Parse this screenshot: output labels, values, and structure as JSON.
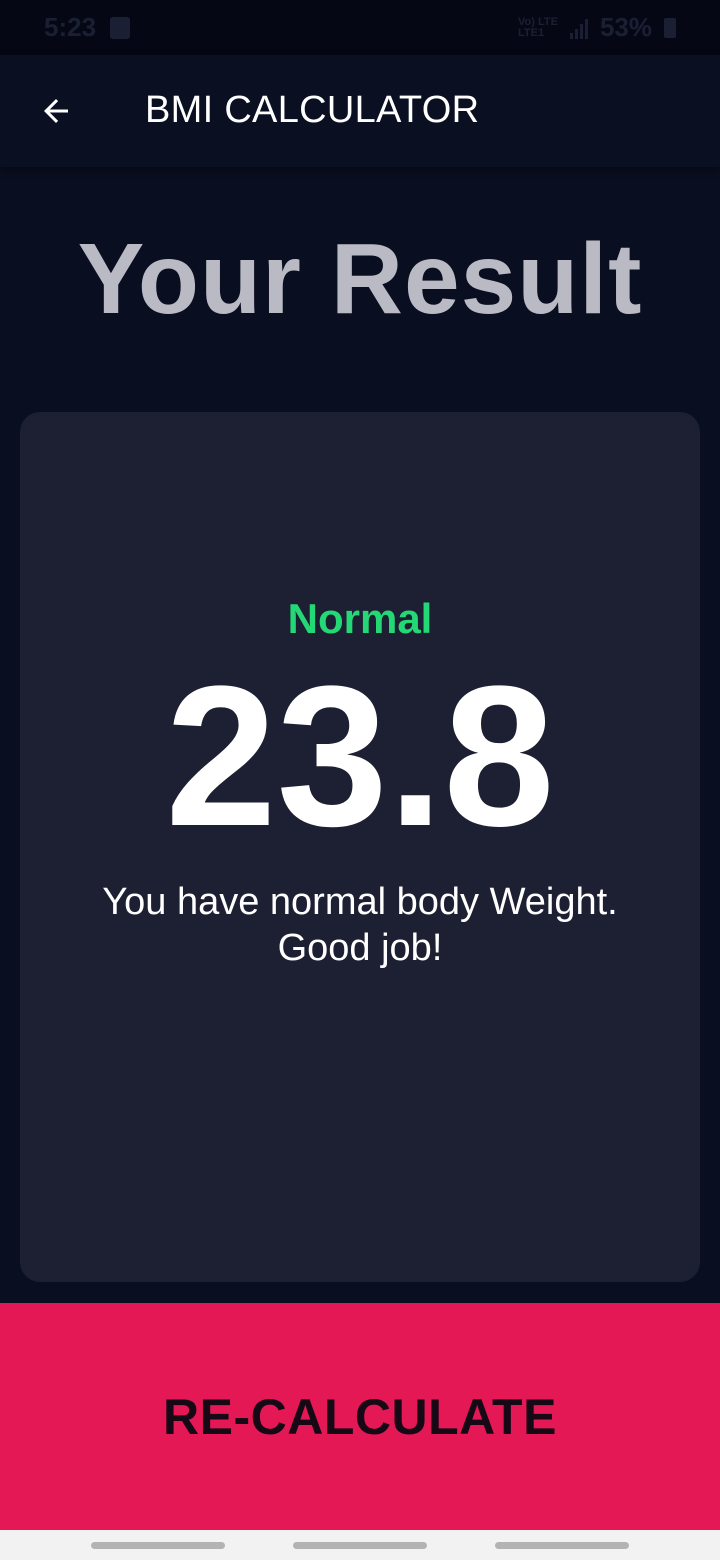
{
  "status_bar": {
    "time": "5:23",
    "network": "Vo) LTE\nLTE1",
    "battery": "53%"
  },
  "app_bar": {
    "title": "BMI CALCULATOR",
    "back_icon": "arrow-left-icon"
  },
  "result": {
    "heading": "Your Result",
    "category": "Normal",
    "bmi_value": "23.8",
    "interpretation": "You have normal body Weight. Good job!"
  },
  "actions": {
    "recalculate_label": "RE-CALCULATE"
  },
  "colors": {
    "background": "#0a0e21",
    "card": "#1d1f33",
    "category_normal": "#24d876",
    "accent_button": "#e31855"
  }
}
